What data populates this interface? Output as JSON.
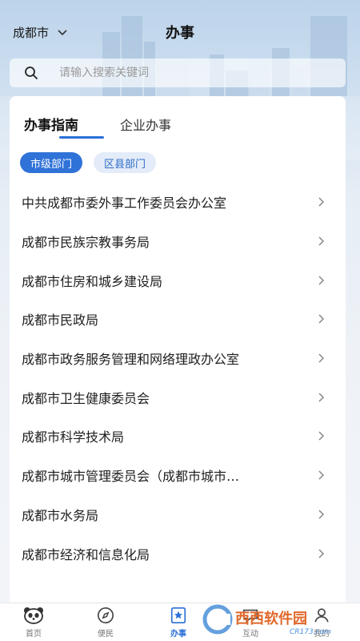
{
  "header": {
    "city": "成都市",
    "title": "办事"
  },
  "search": {
    "placeholder": "请输入搜索关键词"
  },
  "tabs": [
    {
      "label": "办事指南",
      "active": true
    },
    {
      "label": "企业办事",
      "active": false
    }
  ],
  "chips": [
    {
      "label": "市级部门",
      "active": true
    },
    {
      "label": "区县部门",
      "active": false
    }
  ],
  "departments": [
    "中共成都市委外事工作委员会办公室",
    "成都市民族宗教事务局",
    "成都市住房和城乡建设局",
    "成都市民政局",
    "成都市政务服务管理和网络理政办公室",
    "成都市卫生健康委员会",
    "成都市科学技术局",
    "成都市城市管理委员会（成都市城市…",
    "成都市水务局",
    "成都市经济和信息化局"
  ],
  "tabbar": [
    {
      "label": "首页",
      "icon": "panda-icon"
    },
    {
      "label": "便民",
      "icon": "compass-icon"
    },
    {
      "label": "办事",
      "icon": "star-bookmark-icon",
      "active": true
    },
    {
      "label": "互动",
      "icon": "chat-icon"
    },
    {
      "label": "我的",
      "icon": "user-icon"
    }
  ],
  "watermark": {
    "brand": "西西软件园",
    "site": "CR173.com"
  },
  "colors": {
    "accent": "#2a6fd6",
    "chip_inactive_bg": "#e3ecf8"
  }
}
